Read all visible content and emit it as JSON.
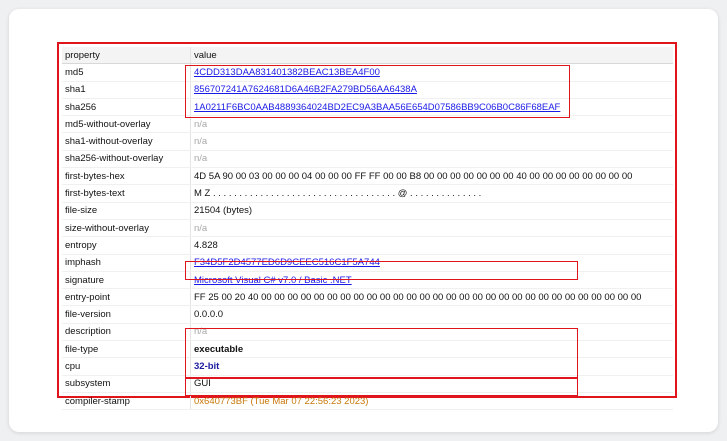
{
  "columns": {
    "property": "property",
    "value": "value"
  },
  "rows": [
    {
      "property": "md5",
      "value": "4CDD313DAA831401382BEAC13BEA4F00",
      "style": "link"
    },
    {
      "property": "sha1",
      "value": "856707241A7624681D6A46B2FA279BD56AA6438A",
      "style": "link"
    },
    {
      "property": "sha256",
      "value": "1A0211F6BC0AAB4889364024BD2EC9A3BAA56E654D07586BB9C06B0C86F68EAF",
      "style": "link"
    },
    {
      "property": "md5-without-overlay",
      "value": "n/a",
      "style": "na"
    },
    {
      "property": "sha1-without-overlay",
      "value": "n/a",
      "style": "na"
    },
    {
      "property": "sha256-without-overlay",
      "value": "n/a",
      "style": "na"
    },
    {
      "property": "first-bytes-hex",
      "value": "4D 5A 90 00 03 00 00 00 04 00 00 00 FF FF 00 00 B8 00 00 00 00 00 00 00 40 00 00 00 00 00 00 00 00",
      "style": "plain"
    },
    {
      "property": "first-bytes-text",
      "value": "M Z . . . . . . . . . . . . . . . . . . . . . . . . . . . . . . . . . . . @ . . . . . . . . . . . . . .",
      "style": "plain"
    },
    {
      "property": "file-size",
      "value": "21504 (bytes)",
      "style": "plain"
    },
    {
      "property": "size-without-overlay",
      "value": "n/a",
      "style": "na"
    },
    {
      "property": "entropy",
      "value": "4.828",
      "style": "plain"
    },
    {
      "property": "imphash",
      "value": "F34D5F2D4577ED6D9CEEC516C1F5A744",
      "style": "link"
    },
    {
      "property": "signature",
      "value": "Microsoft Visual C# v7.0 / Basic .NET",
      "style": "link"
    },
    {
      "property": "entry-point",
      "value": "FF 25 00 20 40 00 00 00 00 00 00 00 00 00 00 00 00 00 00 00 00 00 00 00 00 00 00 00 00 00 00 00 00 00",
      "style": "plain"
    },
    {
      "property": "file-version",
      "value": "0.0.0.0",
      "style": "plain"
    },
    {
      "property": "description",
      "value": "n/a",
      "style": "na"
    },
    {
      "property": "file-type",
      "value": "executable",
      "style": "bold"
    },
    {
      "property": "cpu",
      "value": "32-bit",
      "style": "boldblue"
    },
    {
      "property": "subsystem",
      "value": "GUI",
      "style": "plain"
    },
    {
      "property": "compiler-stamp",
      "value": "0x640773BF (Tue Mar 07 22:56:23 2023)",
      "style": "orange"
    }
  ],
  "highlight_color": "#e0141b"
}
